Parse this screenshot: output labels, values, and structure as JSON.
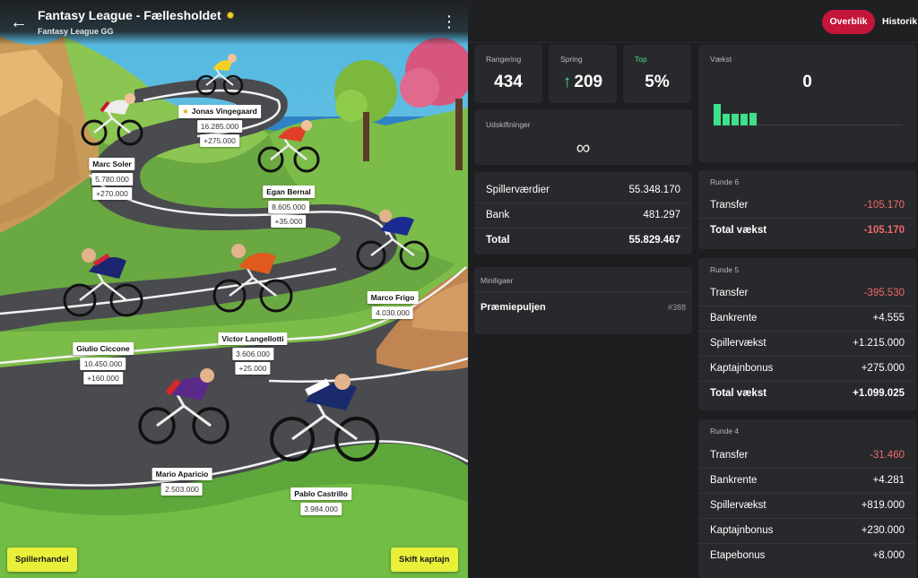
{
  "header": {
    "title": "Fantasy League - Fællesholdet",
    "subtitle": "Fantasy League GG"
  },
  "riders": [
    {
      "name": "Jonas Vingegaard",
      "captain": true,
      "values": [
        "16.285.000",
        "+275.000"
      ]
    },
    {
      "name": "Marc Soler",
      "values": [
        "5.780.000",
        "+270.000"
      ]
    },
    {
      "name": "Egan Bernal",
      "values": [
        "8.605.000",
        "+35.000"
      ]
    },
    {
      "name": "Marco Frigo",
      "values": [
        "4.030.000"
      ]
    },
    {
      "name": "Giulio Ciccone",
      "values": [
        "10.450.000",
        "+160.000"
      ]
    },
    {
      "name": "Victor Langellotti",
      "values": [
        "3.606.000",
        "+25.000"
      ]
    },
    {
      "name": "Mario Aparicio",
      "values": [
        "2.503.000"
      ]
    },
    {
      "name": "Pablo Castrillo",
      "values": [
        "3.984.000"
      ]
    }
  ],
  "actions": {
    "trade": "Spillerhandel",
    "captain": "Skift kaptajn"
  },
  "tabs": {
    "overview": "Overblik",
    "history": "Historik"
  },
  "stats": {
    "rank_label": "Rangering",
    "rank_value": "434",
    "jump_label": "Spring",
    "jump_value": "209",
    "top_label": "Top",
    "top_value": "5%",
    "growth_label": "Vækst",
    "growth_value": "0",
    "growth_bars": [
      1,
      0.55,
      0.55,
      0.55,
      0.6
    ],
    "transfers_label": "Udskiftninger",
    "transfers_value": "∞"
  },
  "values_card": {
    "rows": [
      {
        "label": "Spillerværdier",
        "value": "55.348.170"
      },
      {
        "label": "Bank",
        "value": "481.297"
      },
      {
        "label": "Total",
        "value": "55.829.467",
        "bold": true
      }
    ]
  },
  "minileagues": {
    "label": "Miniligaer",
    "name": "Præmiepuljen",
    "rank": "#388"
  },
  "rounds": [
    {
      "title": "Runde 6",
      "rows": [
        {
          "label": "Transfer",
          "value": "-105.170",
          "neg": true
        },
        {
          "label": "Total vækst",
          "value": "-105.170",
          "neg": true,
          "bold": true
        }
      ]
    },
    {
      "title": "Runde 5",
      "rows": [
        {
          "label": "Transfer",
          "value": "-395.530",
          "neg": true
        },
        {
          "label": "Bankrente",
          "value": "+4.555"
        },
        {
          "label": "Spillervækst",
          "value": "+1.215.000"
        },
        {
          "label": "Kaptajnbonus",
          "value": "+275.000"
        },
        {
          "label": "Total vækst",
          "value": "+1.099.025",
          "bold": true
        }
      ]
    },
    {
      "title": "Runde 4",
      "rows": [
        {
          "label": "Transfer",
          "value": "-31.460",
          "neg": true
        },
        {
          "label": "Bankrente",
          "value": "+4.281"
        },
        {
          "label": "Spillervækst",
          "value": "+819.000"
        },
        {
          "label": "Kaptajnbonus",
          "value": "+230.000"
        },
        {
          "label": "Etapebonus",
          "value": "+8.000"
        }
      ]
    }
  ],
  "colors": {
    "accent": "#c5153a",
    "negative": "#f06a6a",
    "positive": "#3ee089",
    "button": "#e8f03a"
  }
}
